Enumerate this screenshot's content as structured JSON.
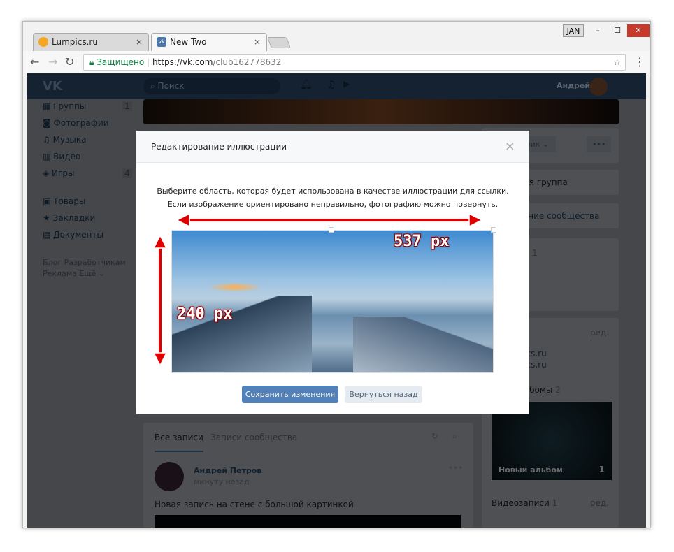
{
  "window": {
    "user_badge": "JAN",
    "minimize": "–",
    "maximize": "☐",
    "close": "✕"
  },
  "tabs": [
    {
      "label": "Lumpics.ru",
      "close": "×",
      "color": "#f5a623"
    },
    {
      "label": "New Two",
      "close": "×",
      "color": "#4a76a8",
      "icon_text": "vk"
    }
  ],
  "address": {
    "secure_label": "Защищено",
    "url_host": "https://vk.com",
    "url_path": "/club162778632"
  },
  "vk": {
    "logo": "VK",
    "search_placeholder": "Поиск",
    "user_name": "Андрей"
  },
  "sidebar": {
    "items": [
      {
        "label": "Группы",
        "count": "1"
      },
      {
        "label": "Фотографии"
      },
      {
        "label": "Музыка"
      },
      {
        "label": "Видео"
      },
      {
        "label": "Игры",
        "count": "4"
      },
      {
        "label": "Товары"
      },
      {
        "label": "Закладки"
      },
      {
        "label": "Документы"
      }
    ],
    "footer": [
      "Блог",
      "Разработчикам",
      "Реклама",
      "Ещё ⌄"
    ]
  },
  "right": {
    "member_button": "Участник ⌄",
    "more": "•••",
    "group_type": "Закрытая группа",
    "manage": "Управление сообщества",
    "count1": "1",
    "edit": "ред.",
    "link1": "lumpics.ru",
    "link2": "lumpics.ru",
    "albums": "Фотоальбомы",
    "albums_count": "2",
    "album_name": "Новый альбом",
    "album_count": "1",
    "videos": "Видеозаписи",
    "videos_count": "1",
    "videos_edit": "ред."
  },
  "wall": {
    "tabs": [
      "Все записи",
      "Записи сообщества"
    ],
    "author": "Андрей Петров",
    "time": "минуту назад",
    "text": "Новая запись на стене с большой картинкой"
  },
  "modal": {
    "title": "Редактирование иллюстрации",
    "close": "×",
    "line1": "Выберите область, которая будет использована в качестве иллюстрации для ссылки.",
    "line2": "Если изображение ориентировано неправильно, фотографию можно повернуть.",
    "save": "Сохранить изменения",
    "back": "Вернуться назад",
    "width_label": "537 px",
    "height_label": "240 px",
    "arrow_color": "#e00000"
  }
}
